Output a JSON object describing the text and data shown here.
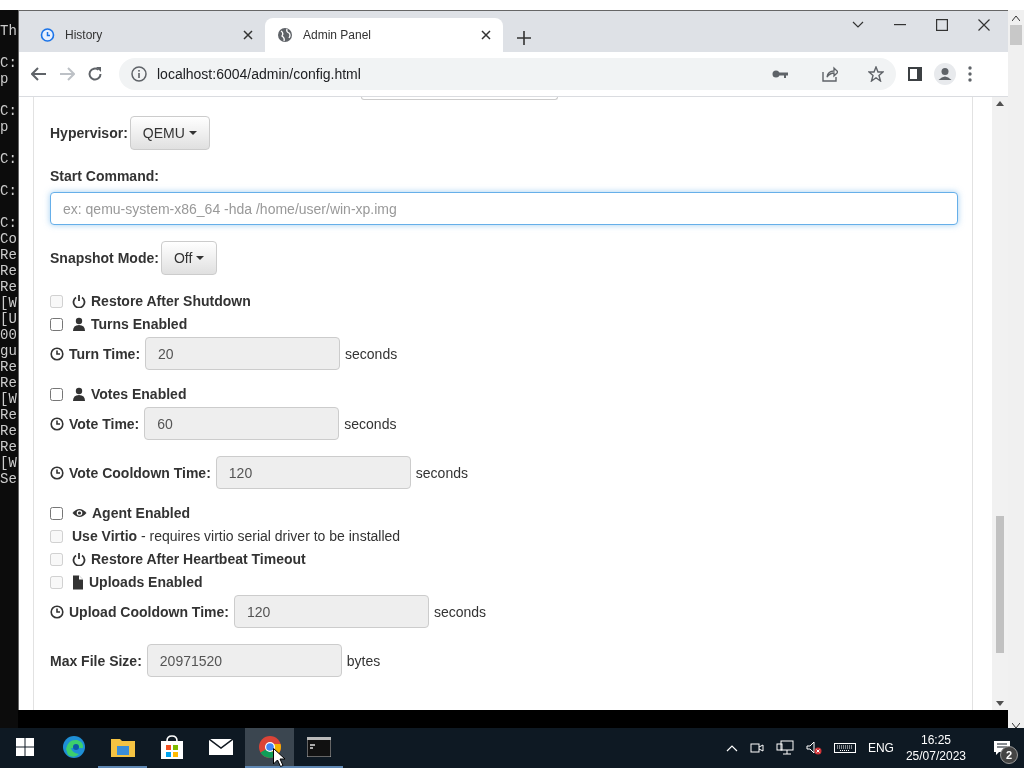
{
  "background_console": {
    "blocks": [
      [
        "Th"
      ],
      [
        "C:",
        "p"
      ],
      [
        "C:",
        "p"
      ],
      [
        "C:"
      ],
      [
        "C:"
      ],
      [
        "C:",
        "Co",
        "Re",
        "Re",
        "Re",
        "[W",
        "[U",
        "00",
        "gu",
        "Re",
        "Re",
        "[W",
        "Re",
        "Re",
        "Re",
        "[W",
        "Se"
      ]
    ]
  },
  "browser": {
    "tabs": [
      {
        "title": "History",
        "selected": false
      },
      {
        "title": "Admin Panel",
        "selected": true
      }
    ],
    "address": "localhost:6004/admin/config.html",
    "forward_disabled": true
  },
  "form": [
    {
      "kind": "dropdown",
      "label": "Hypervisor:",
      "value": "QEMU"
    },
    {
      "kind": "text_input",
      "label": "Start Command:",
      "placeholder": "ex: qemu-system-x86_64 -hda /home/user/win-xp.img",
      "focused": true
    },
    {
      "kind": "dropdown",
      "label": "Snapshot Mode:",
      "value": "Off"
    },
    {
      "kind": "checkbox",
      "label": "Restore After Shutdown",
      "checked": false,
      "disabled": true
    },
    {
      "kind": "checkbox",
      "label": "Turns Enabled",
      "checked": false,
      "disabled": false
    },
    {
      "kind": "number",
      "label": "Turn Time:",
      "value": "20",
      "unit": "seconds"
    },
    {
      "kind": "checkbox",
      "label": "Votes Enabled",
      "checked": false,
      "disabled": false
    },
    {
      "kind": "number",
      "label": "Vote Time:",
      "value": "60",
      "unit": "seconds"
    },
    {
      "kind": "number",
      "label": "Vote Cooldown Time:",
      "value": "120",
      "unit": "seconds"
    },
    {
      "kind": "checkbox",
      "label": "Agent Enabled",
      "checked": false,
      "disabled": false
    },
    {
      "kind": "checkbox",
      "label": "Use Virtio",
      "note": "- requires virtio serial driver to be installed",
      "checked": false,
      "disabled": true
    },
    {
      "kind": "checkbox",
      "label": "Restore After Heartbeat Timeout",
      "checked": false,
      "disabled": true
    },
    {
      "kind": "checkbox",
      "label": "Uploads Enabled",
      "checked": false,
      "disabled": true
    },
    {
      "kind": "number",
      "label": "Upload Cooldown Time:",
      "value": "120",
      "unit": "seconds"
    },
    {
      "kind": "number",
      "label": "Max File Size:",
      "value": "20971520",
      "unit": "bytes"
    }
  ],
  "taskbar": {
    "apps": [
      {
        "selected": false,
        "running": false
      },
      {
        "selected": false,
        "running": false
      },
      {
        "selected": false,
        "running": true
      },
      {
        "selected": false,
        "running": false
      },
      {
        "selected": false,
        "running": false
      },
      {
        "selected": true,
        "running": true
      },
      {
        "selected": false,
        "running": true
      }
    ],
    "language": "ENG",
    "time": "16:25",
    "date": "25/07/2023",
    "notifications": "2"
  }
}
